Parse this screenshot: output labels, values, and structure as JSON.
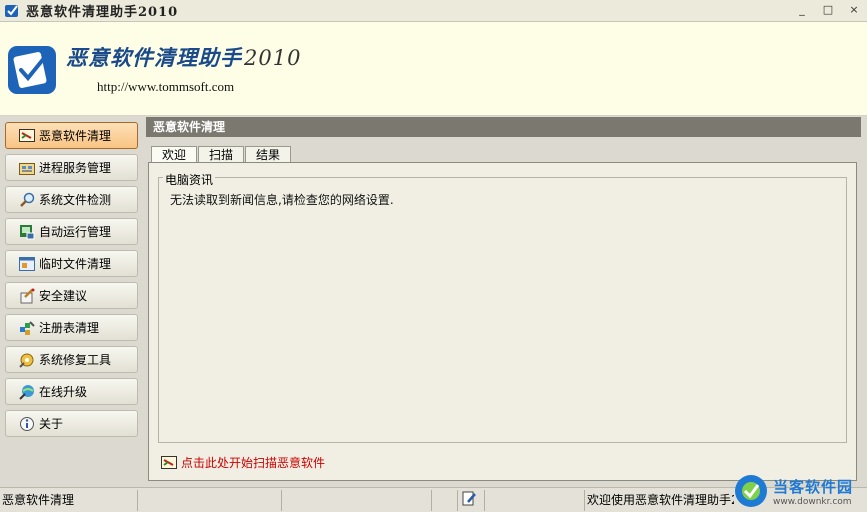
{
  "window": {
    "title": "恶意软件清理助手2010",
    "controls": {
      "minimize": "_",
      "maximize": "□",
      "close": "×"
    }
  },
  "banner": {
    "product_name": "恶意软件清理助手",
    "product_year": "2010",
    "url": "http://www.tommsoft.com"
  },
  "sidebar": {
    "items": [
      {
        "label": "恶意软件清理",
        "icon": "malware-scan-icon"
      },
      {
        "label": "进程服务管理",
        "icon": "process-service-icon"
      },
      {
        "label": "系统文件检测",
        "icon": "magnifier-icon"
      },
      {
        "label": "自动运行管理",
        "icon": "autorun-icon"
      },
      {
        "label": "临时文件清理",
        "icon": "temp-files-icon"
      },
      {
        "label": "安全建议",
        "icon": "security-advice-icon"
      },
      {
        "label": "注册表清理",
        "icon": "registry-icon"
      },
      {
        "label": "系统修复工具",
        "icon": "repair-tool-icon"
      },
      {
        "label": "在线升级",
        "icon": "online-update-icon"
      },
      {
        "label": "关于",
        "icon": "info-icon"
      }
    ],
    "active_index": 0
  },
  "main": {
    "section_title": "恶意软件清理",
    "tabs": [
      {
        "label": "欢迎"
      },
      {
        "label": "扫描"
      },
      {
        "label": "结果"
      }
    ],
    "active_tab": 0,
    "group_title": "电脑资讯",
    "message": "无法读取到新闻信息,请检查您的网络设置.",
    "scan_link": "点击此处开始扫描恶意软件"
  },
  "statusbar": {
    "left_text": "恶意软件清理",
    "right_text": "欢迎使用恶意软件清理助手2010"
  },
  "watermark": {
    "name": "当客软件园",
    "url": "www.downkr.com"
  },
  "colors": {
    "banner_bg": "#fefee6",
    "section_header_bg": "#7b7870",
    "active_nav_bg": "#f9c483",
    "link_red": "#cc0000",
    "logo_blue": "#1d64b8"
  }
}
